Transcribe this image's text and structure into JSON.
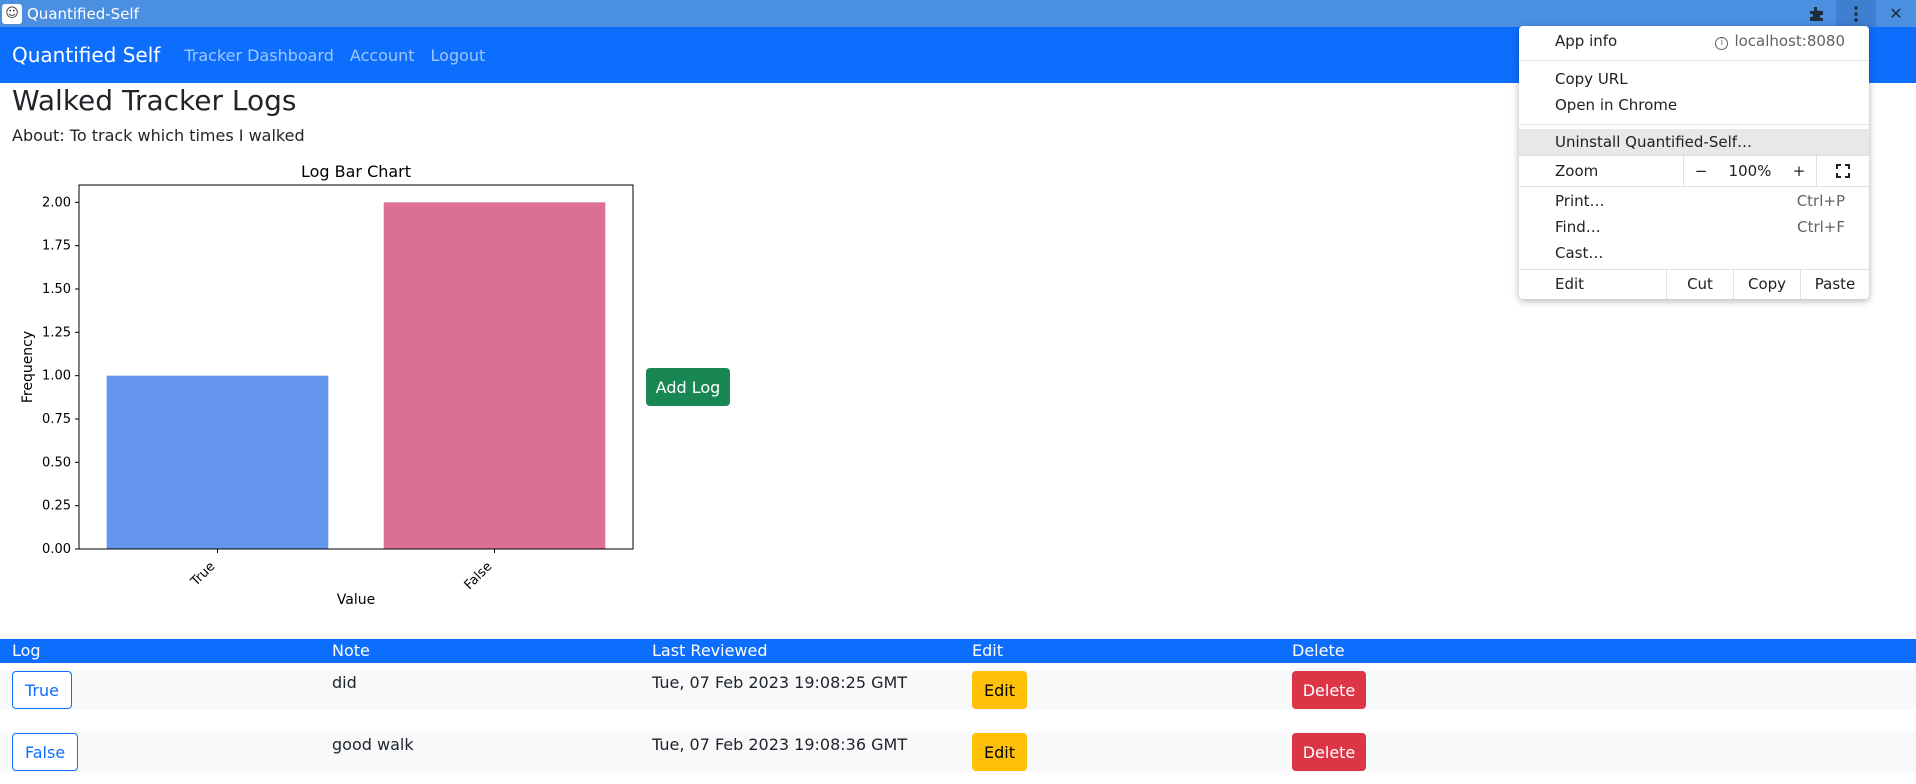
{
  "window": {
    "title": "Quantified-Self"
  },
  "navbar": {
    "brand": "Quantified Self",
    "links": [
      "Tracker Dashboard",
      "Account",
      "Logout"
    ]
  },
  "page": {
    "title": "Walked Tracker Logs",
    "about": "About: To track which times I walked",
    "add_log_label": "Add Log"
  },
  "chart_data": {
    "type": "bar",
    "title": "Log Bar Chart",
    "xlabel": "Value",
    "ylabel": "Frequency",
    "categories": [
      "True",
      "False"
    ],
    "values": [
      1,
      2
    ],
    "colors": [
      "#6495ed",
      "#db7093"
    ],
    "ylim": [
      0,
      2.1
    ],
    "yticks": [
      "0.00",
      "0.25",
      "0.50",
      "0.75",
      "1.00",
      "1.25",
      "1.50",
      "1.75",
      "2.00"
    ],
    "grid": false
  },
  "table": {
    "headers": [
      "Log",
      "Note",
      "Last Reviewed",
      "Edit",
      "Delete"
    ],
    "rows": [
      {
        "log": "True",
        "note": "did",
        "reviewed": "Tue, 07 Feb 2023 19:08:25 GMT",
        "edit": "Edit",
        "delete": "Delete"
      },
      {
        "log": "False",
        "note": "good walk",
        "reviewed": "Tue, 07 Feb 2023 19:08:36 GMT",
        "edit": "Edit",
        "delete": "Delete"
      }
    ]
  },
  "menu": {
    "app_info": "App info",
    "origin": "localhost:8080",
    "copy_url": "Copy URL",
    "open_in_chrome": "Open in Chrome",
    "uninstall": "Uninstall Quantified-Self…",
    "zoom_label": "Zoom",
    "zoom_minus": "−",
    "zoom_value": "100%",
    "zoom_plus": "+",
    "print": "Print…",
    "print_shortcut": "Ctrl+P",
    "find": "Find…",
    "find_shortcut": "Ctrl+F",
    "cast": "Cast…",
    "edit_label": "Edit",
    "cut": "Cut",
    "copy": "Copy",
    "paste": "Paste"
  }
}
